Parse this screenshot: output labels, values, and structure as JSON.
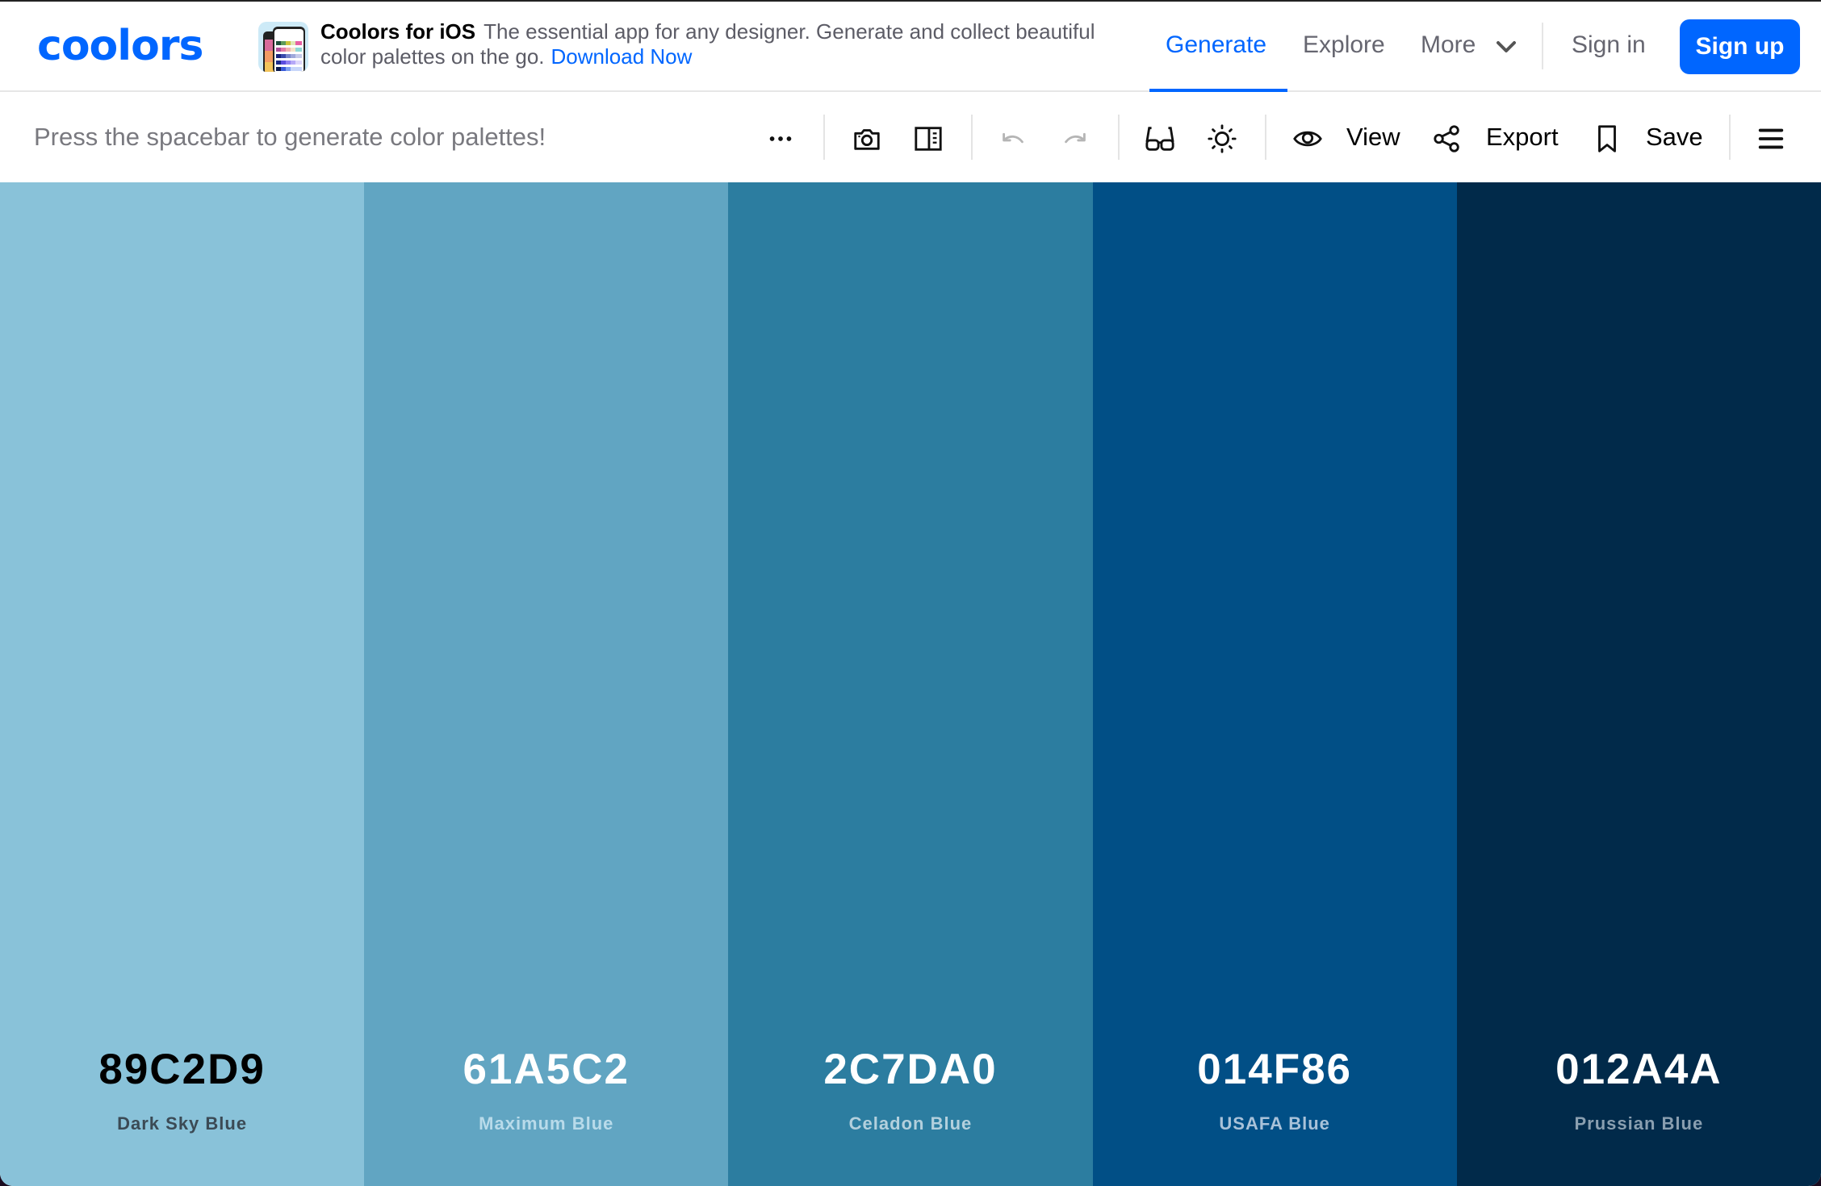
{
  "header": {
    "logo_text": "coolors",
    "brand_color": "#0066ff",
    "ad": {
      "title": "Coolors for iOS",
      "description": "The essential app for any designer. Generate and collect beautiful color palettes on the go.",
      "link": "Download Now"
    },
    "nav": [
      {
        "label": "Generate",
        "active": true
      },
      {
        "label": "Explore",
        "active": false
      },
      {
        "label": "More",
        "active": false
      }
    ],
    "sign_in": "Sign in",
    "sign_up": "Sign up"
  },
  "toolbar": {
    "hint": "Press the spacebar to generate color palettes!",
    "icons": {
      "more": "more-options-icon",
      "camera": "camera-icon",
      "sidebar": "sidebar-icon",
      "undo": "undo-icon",
      "redo": "redo-icon",
      "glasses": "color-blindness-icon",
      "sun": "adjust-palette-icon",
      "eye": "eye-icon",
      "share": "share-icon",
      "bookmark": "bookmark-icon",
      "menu": "hamburger-menu-icon"
    },
    "view_label": "View",
    "export_label": "Export",
    "save_label": "Save"
  },
  "palette": [
    {
      "hex": "89C2D9",
      "name": "Dark Sky Blue",
      "color": "#89C2D9",
      "hex_color": "#000000",
      "name_color": "#3b4a55"
    },
    {
      "hex": "61A5C2",
      "name": "Maximum Blue",
      "color": "#61A5C2",
      "hex_color": "#ffffff",
      "name_color": "#b9dbea"
    },
    {
      "hex": "2C7DA0",
      "name": "Celadon Blue",
      "color": "#2C7DA0",
      "hex_color": "#ffffff",
      "name_color": "#b3d0dd"
    },
    {
      "hex": "014F86",
      "name": "USAFA Blue",
      "color": "#014F86",
      "hex_color": "#ffffff",
      "name_color": "#a9c2d9"
    },
    {
      "hex": "012A4A",
      "name": "Prussian Blue",
      "color": "#012A4A",
      "hex_color": "#ffffff",
      "name_color": "#8a9fb0"
    }
  ]
}
